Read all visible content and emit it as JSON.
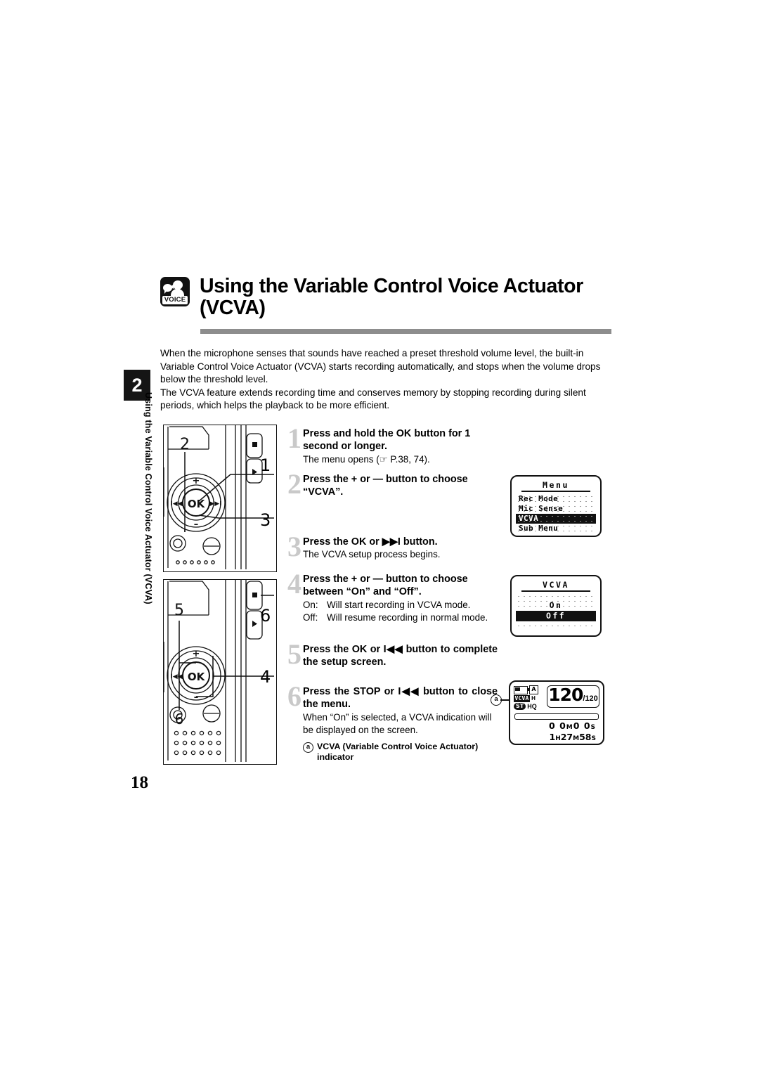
{
  "side_tab": {
    "chapter_number": "2",
    "vertical_label": "Using the Variable Control Voice Actuator (VCVA)"
  },
  "header": {
    "icon_name": "voice-icon",
    "icon_word": "VOICE",
    "title_line1": "Using the Variable Control Voice Actuator",
    "title_line2": "(VCVA)"
  },
  "intro": {
    "paragraph1": "When the microphone senses that sounds have reached a preset threshold volume level, the built-in Variable Control Voice Actuator (VCVA) starts recording automatically, and stops when the volume drops below the threshold level.",
    "paragraph2": "The VCVA feature extends recording time and conserves memory by stopping recording during silent periods, which helps the playback to be more efficient."
  },
  "steps": [
    {
      "number": "1",
      "heading": "Press and hold the OK button for 1 second or longer.",
      "sub": "The menu opens (☞ P.38, 74)."
    },
    {
      "number": "2",
      "heading": "Press the + or — button to choose “VCVA”.",
      "sub": ""
    },
    {
      "number": "3",
      "heading": "Press the OK or ▶▶I button.",
      "sub": "The VCVA setup process begins."
    },
    {
      "number": "4",
      "heading": "Press the + or — button to choose between “On” and “Off”.",
      "def_on_key": "On:",
      "def_on_val": "Will start recording in VCVA mode.",
      "def_off_key": "Off:",
      "def_off_val": "Will resume recording in normal mode."
    },
    {
      "number": "5",
      "heading": "Press the OK or I◀◀ button to complete the setup screen.",
      "sub": ""
    },
    {
      "number": "6",
      "heading": "Press the STOP or I◀◀ button to close the menu.",
      "sub": "When “On” is selected, a VCVA indication will be displayed on the screen.",
      "note_marker": "a",
      "note_text": "VCVA (Variable Control Voice Actuator) indicator"
    }
  ],
  "lcd_menu": {
    "title": "Menu",
    "items": [
      {
        "label": "Rec Mode",
        "selected": false
      },
      {
        "label": "Mic Sense",
        "selected": false
      },
      {
        "label": "VCVA",
        "selected": true
      },
      {
        "label": "Sub Menu",
        "selected": false
      }
    ]
  },
  "lcd_vcva": {
    "title": "VCVA",
    "options": [
      {
        "label": "On",
        "selected": false
      },
      {
        "label": "Off",
        "selected": true
      }
    ]
  },
  "lcd_status": {
    "battery_icon": "battery-icon",
    "mode_badge": "A",
    "vcva_badge": "VCVA",
    "mic_badge": "H",
    "stereo_badge": "ST",
    "quality_badge": "HQ",
    "file_current": "120",
    "file_total": "/120",
    "elapsed": "0 0",
    "elapsed_unit_m": "M",
    "elapsed_sec": "0 0",
    "elapsed_unit_s": "S",
    "remaining_h": "1",
    "remaining_h_unit": "H",
    "remaining_m": "27",
    "remaining_m_unit": "M",
    "remaining_s": "58",
    "remaining_s_unit": "S",
    "leader_marker": "a"
  },
  "device_top": {
    "callouts": [
      "2",
      "1",
      "3"
    ],
    "ok_label": "OK",
    "plus_label": "+",
    "minus_label": "—"
  },
  "device_bottom": {
    "callouts": [
      "5",
      "6",
      "4",
      "6"
    ],
    "ok_label": "OK",
    "plus_label": "+",
    "minus_label": "—"
  },
  "page": {
    "number": "18"
  }
}
